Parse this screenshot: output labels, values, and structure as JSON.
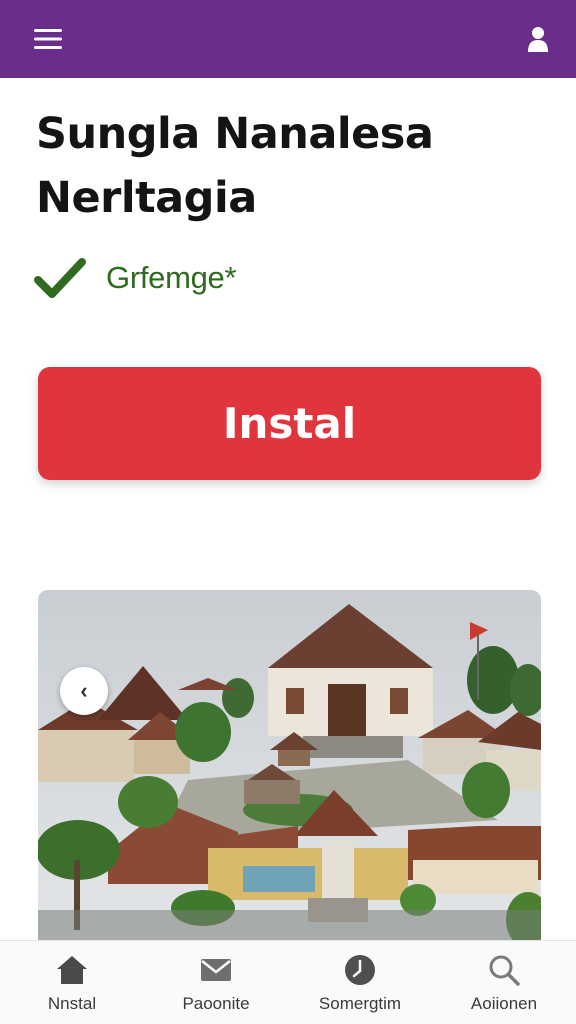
{
  "header": {
    "menu_icon": "hamburger-menu-icon",
    "profile_icon": "user-profile-icon",
    "background_color": "#6a2d8c"
  },
  "app": {
    "title_line1": "Sungla Nanalesa",
    "title_line2": "Nerltagia",
    "status_label": "Grfemge*",
    "status_icon": "checkmark-icon",
    "status_color": "#2f6b1f"
  },
  "actions": {
    "install_label": "Instal",
    "install_color": "#e0353d"
  },
  "gallery": {
    "prev_icon": "chevron-left-icon",
    "prev_glyph": "‹"
  },
  "bottom_nav": {
    "items": [
      {
        "label": "Nnstal",
        "icon": "home-icon"
      },
      {
        "label": "Paoonite",
        "icon": "mail-icon"
      },
      {
        "label": "Somergtim",
        "icon": "clock-icon"
      },
      {
        "label": "Aoiionen",
        "icon": "search-icon"
      }
    ]
  }
}
